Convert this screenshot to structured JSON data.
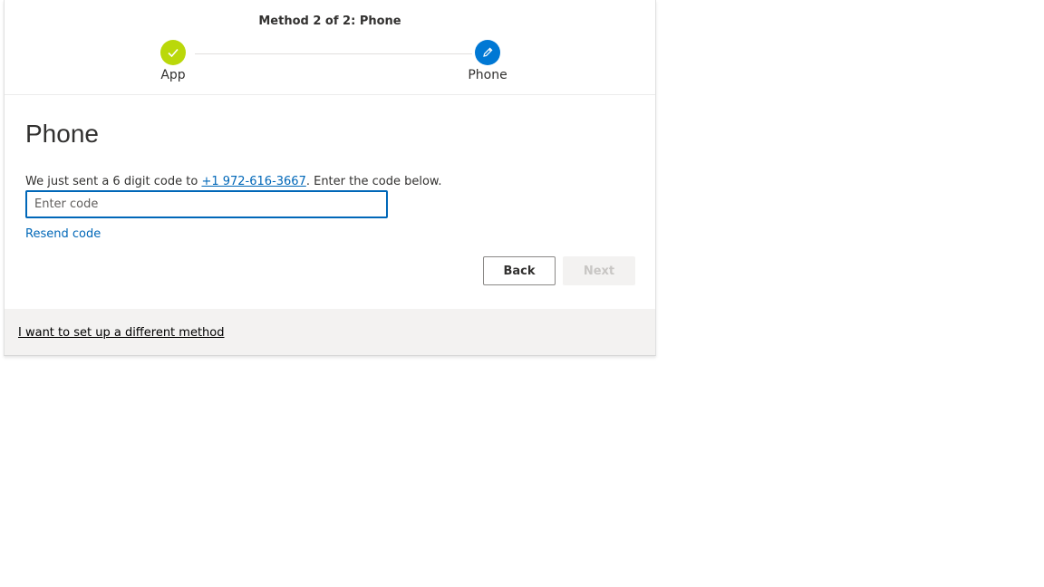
{
  "header": {
    "step_title": "Method 2 of 2: Phone",
    "steps": [
      {
        "label": "App",
        "state": "done",
        "icon": "checkmark-icon",
        "color": "#bad80a"
      },
      {
        "label": "Phone",
        "state": "current",
        "icon": "pencil-icon",
        "color": "#0078d4"
      }
    ]
  },
  "main": {
    "title": "Phone",
    "instruction_prefix": "We just sent a 6 digit code to ",
    "phone_number": "+1 972-616-3667",
    "instruction_suffix": ". Enter the code below.",
    "code_input": {
      "value": "",
      "placeholder": "Enter code"
    },
    "resend_label": "Resend code",
    "back_label": "Back",
    "next_label": "Next"
  },
  "footer": {
    "different_method_label": "I want to set up a different method"
  },
  "colors": {
    "accent": "#0067b8",
    "step_done": "#bad80a",
    "step_current": "#0078d4"
  }
}
